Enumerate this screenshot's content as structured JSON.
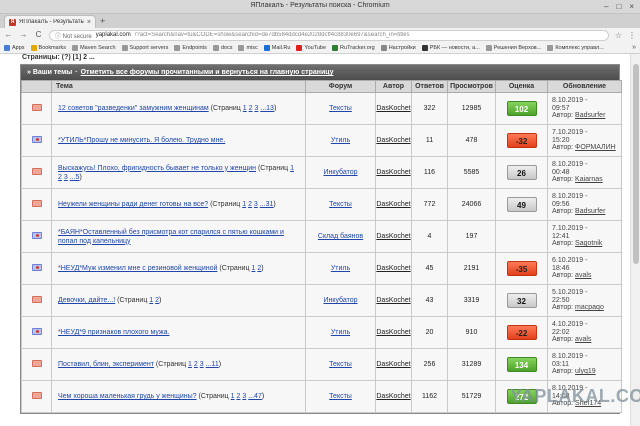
{
  "window": {
    "title": "ЯПлакалъ - Результаты поиска - Chromium"
  },
  "tab": {
    "label": "ЯПлакалъ - Результаты пои",
    "close": "×",
    "new_tab": "+"
  },
  "toolbar": {
    "back": "←",
    "forward": "→",
    "reload": "C",
    "security": "ⓘ Not secure",
    "host": "yaplakal.com",
    "path": "/?act=Search&nav=tu&CODE=show&searchid=de7db584ddcd4e2028dcff4c8830e697&search_in=titles",
    "menu": "⋮"
  },
  "bookmarks": {
    "items": [
      {
        "label": "Apps",
        "color": "#4a7bd8"
      },
      {
        "label": "Bookmarks",
        "color": "#e0a800"
      },
      {
        "label": "Maven Search",
        "color": "#999999"
      },
      {
        "label": "Support servers",
        "color": "#999999"
      },
      {
        "label": "Endpoints",
        "color": "#999999"
      },
      {
        "label": "docs",
        "color": "#999999"
      },
      {
        "label": "misc",
        "color": "#999999"
      },
      {
        "label": "Mail.Ru",
        "color": "#1b6fd6"
      },
      {
        "label": "YouTube",
        "color": "#e02020"
      },
      {
        "label": "RuTracker.org",
        "color": "#2e7d32"
      },
      {
        "label": "Настройки",
        "color": "#888888"
      },
      {
        "label": "РБК — новости, а...",
        "color": "#333333"
      },
      {
        "label": "Решения Верхов...",
        "color": "#999999"
      },
      {
        "label": "Комплекс управл...",
        "color": "#999999"
      }
    ],
    "more": "»"
  },
  "page": {
    "cut_text": "Страницы: (?) [1] 2 ...",
    "section": {
      "title": "» Ваши темы",
      "separator": "·",
      "link": "Отметить все форумы прочитанными и вернуться на главную страницу"
    },
    "headers": {
      "topic": "Тема",
      "forum": "Форум",
      "author": "Автор",
      "replies": "Ответов",
      "views": "Просмотров",
      "rating": "Оценка",
      "update": "Обновление"
    },
    "rows": [
      {
        "icon": "env",
        "title": "12 советов \"разведенки\" замужним женщинам",
        "pages_prefix": " (Страниц ",
        "pages": [
          "1",
          "2",
          "3",
          "...13"
        ],
        "forum": "Тексты",
        "author": "DasKochet",
        "replies": "322",
        "views": "12985",
        "rating": "102",
        "rtype": "pos",
        "upd_date": "8.10.2019 -",
        "upd_time": "09:57",
        "upd_label": "Автор:",
        "upd_author": "Badsurfer"
      },
      {
        "icon": "flag",
        "title": "*УТИЛЬ*Прошу не минусить. Я болею. Трудно мне.",
        "pages_prefix": "",
        "pages": [],
        "forum": "Утиль",
        "author": "DasKochet",
        "replies": "11",
        "views": "478",
        "rating": "-32",
        "rtype": "neg",
        "upd_date": "7.10.2019 -",
        "upd_time": "15:20",
        "upd_label": "Автор:",
        "upd_author": "ФОРМАЛИН"
      },
      {
        "icon": "env",
        "title": "Выскажусь! Плохо, фригидность бывает не только у женщин",
        "pages_prefix": " (Страниц ",
        "pages": [
          "1",
          "2",
          "3",
          "...5"
        ],
        "forum": "Инкубатор",
        "author": "DasKochet",
        "replies": "116",
        "views": "5585",
        "rating": "26",
        "rtype": "neu",
        "upd_date": "8.10.2019 -",
        "upd_time": "00:48",
        "upd_label": "Автор:",
        "upd_author": "Kaiarnas"
      },
      {
        "icon": "env",
        "title": "Неужели женщины ради денег готовы на все?",
        "pages_prefix": " (Страниц ",
        "pages": [
          "1",
          "2",
          "3",
          "...31"
        ],
        "forum": "Тексты",
        "author": "DasKochet",
        "replies": "772",
        "views": "24066",
        "rating": "49",
        "rtype": "neu",
        "upd_date": "8.10.2019 -",
        "upd_time": "09:56",
        "upd_label": "Автор:",
        "upd_author": "Badsurfer"
      },
      {
        "icon": "flag",
        "title": "*БАЯН*Оставленный без присмотра кот спарился с пятью кошками и попал под капельницу",
        "pages_prefix": "",
        "pages": [],
        "forum": "Склад баянов",
        "author": "DasKochet",
        "replies": "4",
        "views": "197",
        "rating": "",
        "rtype": "none",
        "upd_date": "7.10.2019 -",
        "upd_time": "12:41",
        "upd_label": "Автор:",
        "upd_author": "Sagotnik"
      },
      {
        "icon": "flag",
        "title": "*НЕУД*Муж изменил мне с резиновой женщиной",
        "pages_prefix": " (Страниц ",
        "pages": [
          "1",
          "2"
        ],
        "forum": "Утиль",
        "author": "DasKochet",
        "replies": "45",
        "views": "2191",
        "rating": "-35",
        "rtype": "neg",
        "upd_date": "6.10.2019 -",
        "upd_time": "18:46",
        "upd_label": "Автор:",
        "upd_author": "avals"
      },
      {
        "icon": "env",
        "title": "Девочки, дайте...!",
        "pages_prefix": " (Страниц ",
        "pages": [
          "1",
          "2"
        ],
        "forum": "Инкубатор",
        "author": "DasKochet",
        "replies": "43",
        "views": "3319",
        "rating": "32",
        "rtype": "neu",
        "upd_date": "5.10.2019 -",
        "upd_time": "22:50",
        "upd_label": "Автор:",
        "upd_author": "macpaqo"
      },
      {
        "icon": "flag",
        "title": "*НЕУД*9 признаков плохого мужа.",
        "pages_prefix": "",
        "pages": [],
        "forum": "Утиль",
        "author": "DasKochet",
        "replies": "20",
        "views": "910",
        "rating": "-22",
        "rtype": "neg",
        "upd_date": "4.10.2019 -",
        "upd_time": "22:02",
        "upd_label": "Автор:",
        "upd_author": "avals"
      },
      {
        "icon": "env",
        "title": "Поставил, блин, эксперимент",
        "pages_prefix": " (Страниц ",
        "pages": [
          "1",
          "2",
          "3",
          "...11"
        ],
        "forum": "Тексты",
        "author": "DasKochet",
        "replies": "256",
        "views": "31289",
        "rating": "134",
        "rtype": "pos",
        "upd_date": "8.10.2019 -",
        "upd_time": "03:11",
        "upd_label": "Автор:",
        "upd_author": "ulyq19"
      },
      {
        "icon": "env",
        "title": "Чем хороша маленькая грудь у женщины?",
        "pages_prefix": " (Страниц ",
        "pages": [
          "1",
          "2",
          "3",
          "...47"
        ],
        "forum": "Тексты",
        "author": "DasKochet",
        "replies": "1162",
        "views": "51729",
        "rating": "272",
        "rtype": "pos",
        "upd_date": "8.10.2019 -",
        "upd_time": "14:08",
        "upd_label": "Автор:",
        "upd_author": "Shef174"
      }
    ]
  },
  "watermark": "YAPLAKAL.COM"
}
